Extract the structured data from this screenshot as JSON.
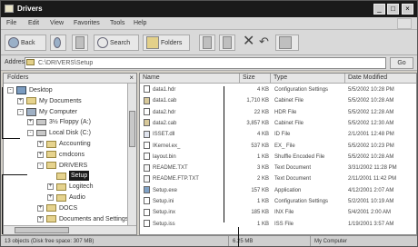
{
  "window": {
    "title": "Drivers",
    "title_controls": [
      "_",
      "□",
      "×"
    ]
  },
  "menu": {
    "items": [
      "File",
      "Edit",
      "View",
      "Favorites",
      "Tools",
      "Help"
    ]
  },
  "toolbar": {
    "back_label": "Back",
    "search_label": "Search",
    "folders_label": "Folders"
  },
  "address": {
    "label": "Address",
    "value": "C:\\DRIVERS\\Setup",
    "go_label": "Go"
  },
  "folders_pane": {
    "title": "Folders",
    "tree": [
      {
        "label": "Desktop",
        "depth": 0,
        "expander": "-",
        "icon": "desktop-icon"
      },
      {
        "label": "My Documents",
        "depth": 1,
        "expander": "+",
        "icon": "folder-icon"
      },
      {
        "label": "My Computer",
        "depth": 1,
        "expander": "-",
        "icon": "computer-icon"
      },
      {
        "label": "3½ Floppy (A:)",
        "depth": 2,
        "expander": "+",
        "icon": "drive-icon"
      },
      {
        "label": "Local Disk (C:)",
        "depth": 2,
        "expander": "-",
        "icon": "drive-icon"
      },
      {
        "label": "Accounting",
        "depth": 3,
        "expander": "+",
        "icon": "folder-icon"
      },
      {
        "label": "cmdcons",
        "depth": 3,
        "expander": "+",
        "icon": "folder-icon"
      },
      {
        "label": "DRIVERS",
        "depth": 3,
        "expander": "-",
        "icon": "folder-icon"
      },
      {
        "label": "Setup",
        "depth": 4,
        "expander": "",
        "icon": "folder-icon",
        "selected": true
      },
      {
        "label": "Logitech",
        "depth": 4,
        "expander": "+",
        "icon": "folder-icon"
      },
      {
        "label": "Audio",
        "depth": 4,
        "expander": "+",
        "icon": "folder-icon"
      },
      {
        "label": "DOCS",
        "depth": 3,
        "expander": "+",
        "icon": "folder-icon"
      },
      {
        "label": "Documents and Settings",
        "depth": 3,
        "expander": "+",
        "icon": "folder-icon"
      }
    ]
  },
  "files_pane": {
    "columns": [
      "Name",
      "Size",
      "Type",
      "Date Modified"
    ],
    "rows": [
      {
        "name": "data1.hdr",
        "size": "4 KB",
        "type": "Configuration Settings",
        "date": "5/5/2002 10:28 PM",
        "icon": "file"
      },
      {
        "name": "data1.cab",
        "size": "1,710 KB",
        "type": "Cabinet File",
        "date": "5/5/2002 10:28 AM",
        "icon": "cab"
      },
      {
        "name": "data2.hdr",
        "size": "22 KB",
        "type": "HDR File",
        "date": "5/5/2002 12:28 AM",
        "icon": "file"
      },
      {
        "name": "data2.cab",
        "size": "3,857 KB",
        "type": "Cabinet File",
        "date": "5/5/2002 12:30 AM",
        "icon": "cab"
      },
      {
        "name": "ISSET.dll",
        "size": "4 KB",
        "type": "ID File",
        "date": "2/1/2001 12:48 PM",
        "icon": "dll"
      },
      {
        "name": "IKernel.ex_",
        "size": "537 KB",
        "type": "EX_ File",
        "date": "5/5/2002 10:23 PM",
        "icon": "file"
      },
      {
        "name": "layout.bin",
        "size": "1 KB",
        "type": "Shuffle Encoded File",
        "date": "5/5/2002 10:28 AM",
        "icon": "file"
      },
      {
        "name": "README.TXT",
        "size": "3 KB",
        "type": "Text Document",
        "date": "3/31/2002 11:28 PM",
        "icon": "text"
      },
      {
        "name": "README.FTP.TXT",
        "size": "2 KB",
        "type": "Text Document",
        "date": "2/11/2001 11:42 PM",
        "icon": "text"
      },
      {
        "name": "Setup.exe",
        "size": "157 KB",
        "type": "Application",
        "date": "4/12/2001 2:07 AM",
        "icon": "exe"
      },
      {
        "name": "Setup.ini",
        "size": "1 KB",
        "type": "Configuration Settings",
        "date": "5/2/2001 10:19 AM",
        "icon": "file"
      },
      {
        "name": "Setup.inx",
        "size": "185 KB",
        "type": "INX File",
        "date": "5/4/2001 2:00 AM",
        "icon": "file"
      },
      {
        "name": "Setup.iss",
        "size": "1 KB",
        "type": "ISS File",
        "date": "1/19/2001 3:57 AM",
        "icon": "file"
      }
    ]
  },
  "statusbar": {
    "left": "13 objects (Disk free space: 307 MB)",
    "middle": "6.25 MB",
    "right": "My Computer"
  }
}
